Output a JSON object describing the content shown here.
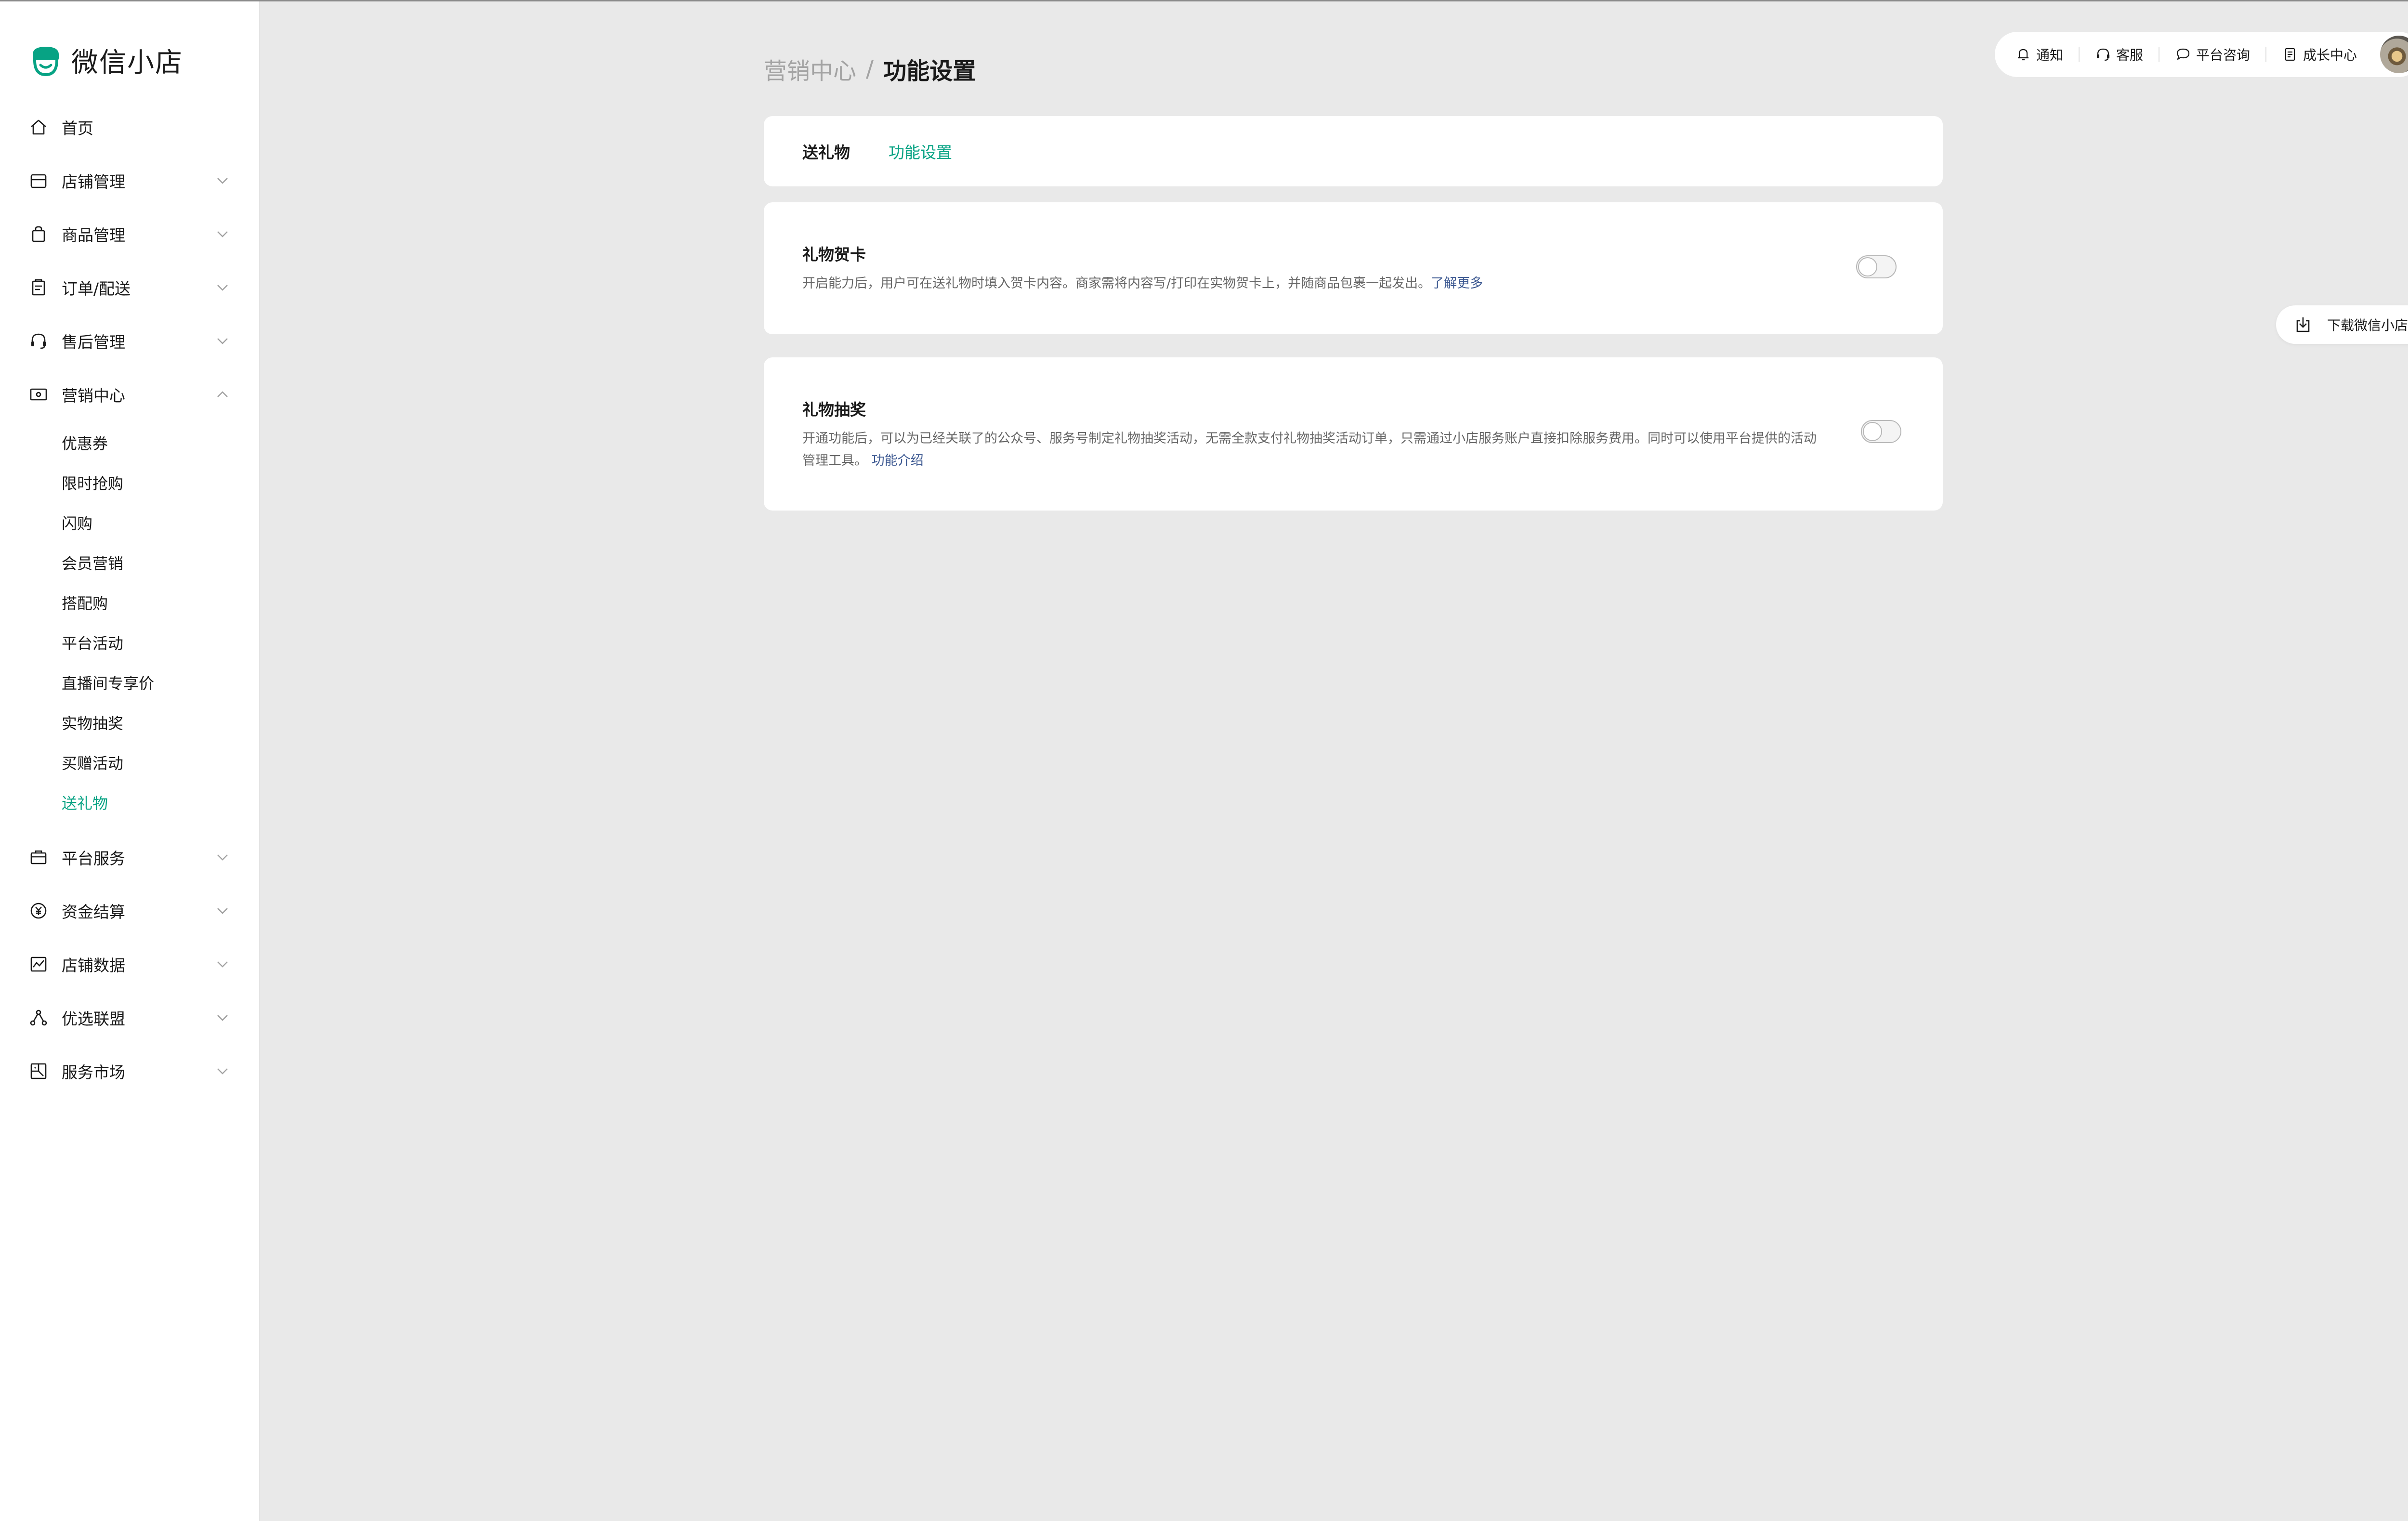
{
  "app": {
    "name": "微信小店"
  },
  "colors": {
    "accent": "#07a384",
    "link": "#3c5891",
    "muted": "#a3a3a3",
    "background": "#e9e9e9"
  },
  "sidebar": {
    "items": [
      {
        "label": "首页",
        "icon": "home-icon"
      },
      {
        "label": "店铺管理",
        "icon": "store-icon",
        "expanded": false
      },
      {
        "label": "商品管理",
        "icon": "bag-icon",
        "expanded": false
      },
      {
        "label": "订单/配送",
        "icon": "clipboard-icon",
        "expanded": false
      },
      {
        "label": "售后管理",
        "icon": "headset-icon",
        "expanded": false
      },
      {
        "label": "营销中心",
        "icon": "ticket-icon",
        "expanded": true
      },
      {
        "label": "平台服务",
        "icon": "briefcase-icon",
        "expanded": false
      },
      {
        "label": "资金结算",
        "icon": "yuan-icon",
        "expanded": false
      },
      {
        "label": "店铺数据",
        "icon": "chart-icon",
        "expanded": false
      },
      {
        "label": "优选联盟",
        "icon": "network-icon",
        "expanded": false
      },
      {
        "label": "服务市场",
        "icon": "market-icon",
        "expanded": false
      }
    ],
    "marketing_subitems": [
      "优惠券",
      "限时抢购",
      "闪购",
      "会员营销",
      "搭配购",
      "平台活动",
      "直播间专享价",
      "实物抽奖",
      "买赠活动",
      "送礼物"
    ],
    "active_subitem": "送礼物"
  },
  "topbar": {
    "buttons": [
      {
        "label": "通知",
        "icon": "bell-icon"
      },
      {
        "label": "客服",
        "icon": "headset-icon"
      },
      {
        "label": "平台咨询",
        "icon": "chat-bubble-icon"
      },
      {
        "label": "成长中心",
        "icon": "document-icon"
      }
    ]
  },
  "breadcrumb": {
    "parent": "营销中心",
    "separator": "/",
    "current": "功能设置"
  },
  "tabs": [
    {
      "label": "送礼物",
      "active": false
    },
    {
      "label": "功能设置",
      "active": true
    }
  ],
  "settings": [
    {
      "title": "礼物贺卡",
      "description": "开启能力后，用户可在送礼物时填入贺卡内容。商家需将内容写/打印在实物贺卡上，并随商品包裹一起发出。",
      "link": "了解更多",
      "enabled": false
    },
    {
      "title": "礼物抽奖",
      "description_line1": "开通功能后，可以为已经关联了的公众号、服务号制定礼物抽奖活动，无需全款支付礼物抽奖活动订单，只需通过小店服务账户直接扣除服务费用。同时可以使用平台提供的活动",
      "description_line2": "管理工具。",
      "link": "功能介绍",
      "enabled": false
    }
  ],
  "float_helper": {
    "label": "下载微信小店助手",
    "icon": "download-icon"
  }
}
